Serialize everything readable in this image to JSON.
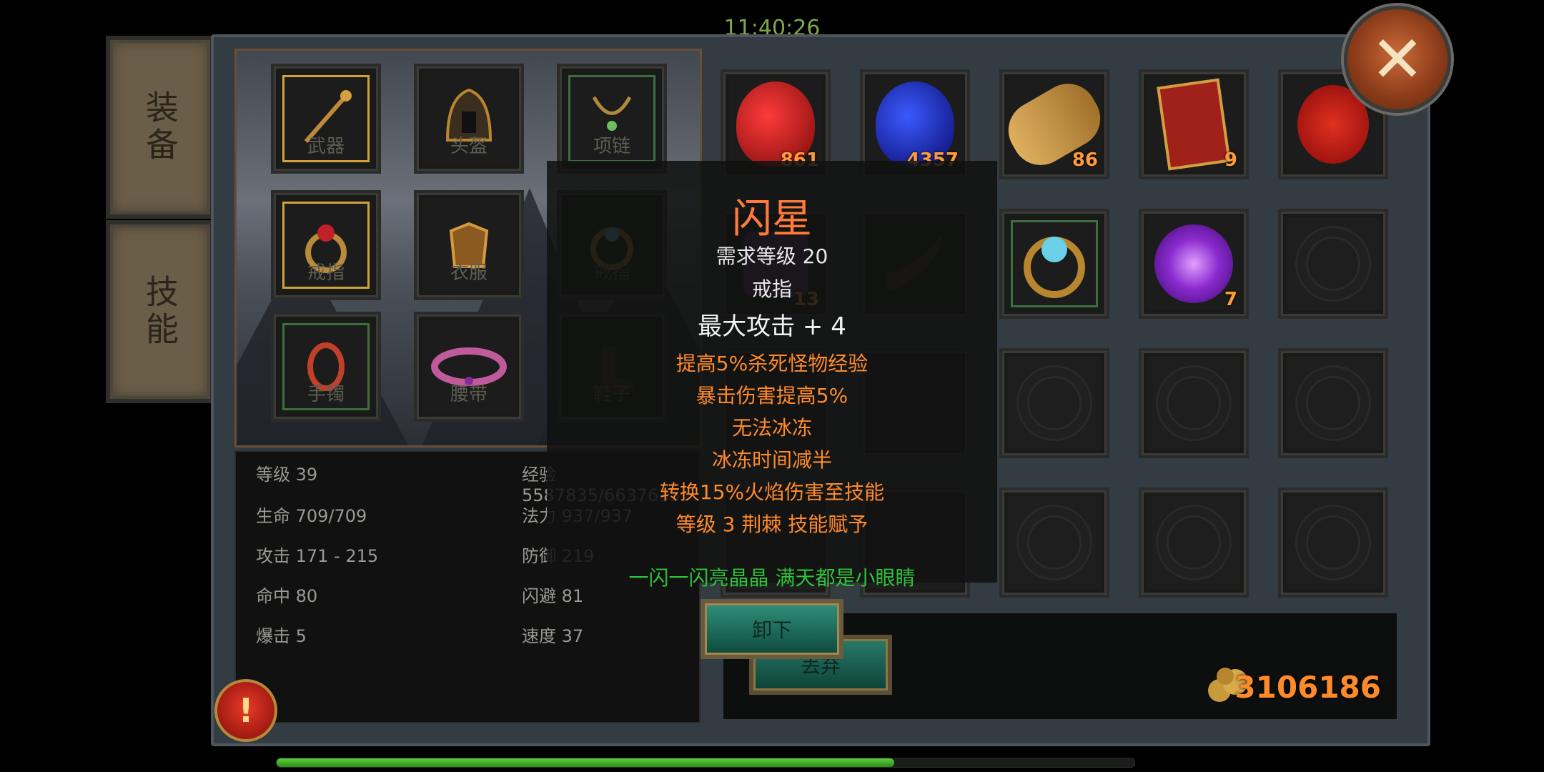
{
  "clock": "11:40:26",
  "side_tabs": {
    "equip": "装备",
    "skill": "技能"
  },
  "equip_slots": [
    "武器",
    "头盔",
    "项链",
    "戒指",
    "衣服",
    "戒指",
    "手镯",
    "腰带",
    "鞋子"
  ],
  "inventory_counts": {
    "red_potion": "861",
    "blue_potion": "4357",
    "scroll": "86",
    "token": "9",
    "rune_box": "13",
    "orb": "7"
  },
  "stats": {
    "level": "等级 39",
    "exp": "经验 5587835/6637633",
    "hp": "生命 709/709",
    "mp": "法力 937/937",
    "attack": "攻击 171 - 215",
    "defense": "防御 219",
    "hit": "命中 80",
    "dodge": "闪避 81",
    "crit": "爆击 5",
    "speed": "速度 37"
  },
  "tooltip": {
    "name": "闪星",
    "requirement": "需求等级 20",
    "type": "戒指",
    "main_stat": "最大攻击 + 4",
    "affixes": [
      "提高5%杀死怪物经验",
      "暴击伤害提高5%",
      "无法冰冻",
      "冰冻时间减半",
      "转换15%火焰伤害至技能",
      "等级 3 荆棘 技能赋予"
    ],
    "flavor": "一闪一闪亮晶晶 满天都是小眼睛"
  },
  "buttons": {
    "unequip": "卸下",
    "behind": "丢弃"
  },
  "gold": "3106186",
  "progress": 0.72,
  "colors": {
    "accent_orange": "#ff8a2a",
    "flavor_green": "#2fc23a",
    "tooltip_title": "#ff7a3a"
  }
}
